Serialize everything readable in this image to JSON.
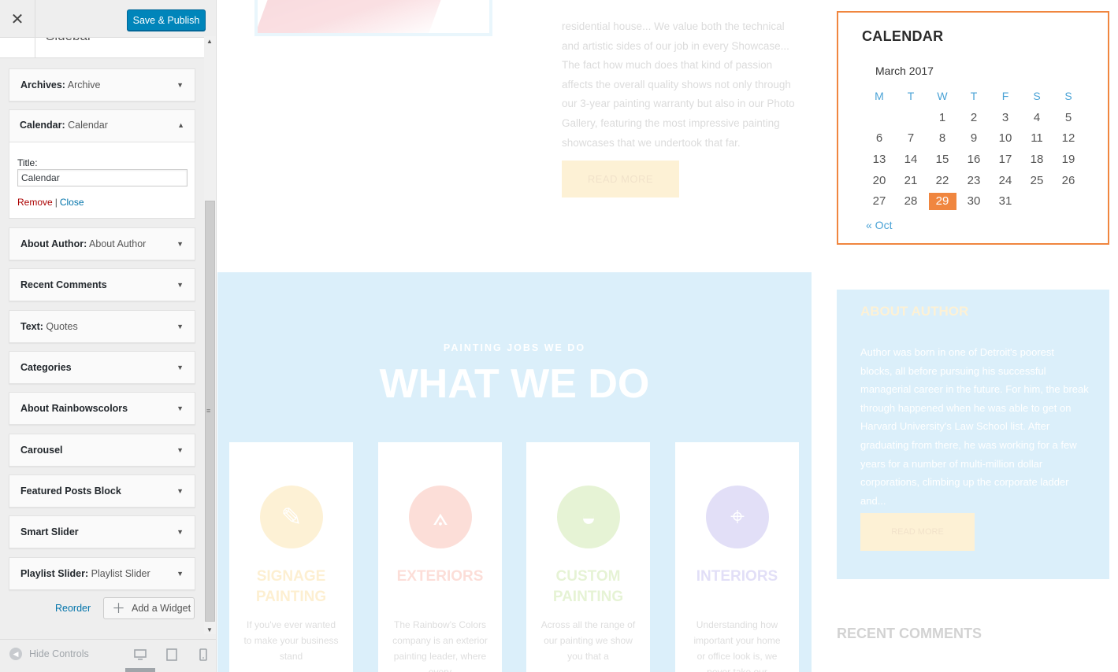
{
  "customizer": {
    "close_icon": "close-icon",
    "publish_label": "Save & Publish",
    "panel_title": "Sidebar",
    "widgets_top": [
      {
        "type": "Archives:",
        "title": "Archive"
      }
    ],
    "open_widget": {
      "type": "Calendar:",
      "title": "Calendar",
      "field_label": "Title:",
      "field_value": "Calendar",
      "remove_label": "Remove",
      "separator": "|",
      "close_label": "Close"
    },
    "widgets": [
      {
        "type": "About Author:",
        "title": "About Author"
      },
      {
        "type": "Recent Comments",
        "title": ""
      },
      {
        "type": "Text:",
        "title": "Quotes"
      },
      {
        "type": "Categories",
        "title": ""
      },
      {
        "type": "About Rainbowscolors",
        "title": ""
      },
      {
        "type": "Carousel",
        "title": ""
      },
      {
        "type": "Featured Posts Block",
        "title": ""
      },
      {
        "type": "Smart Slider",
        "title": ""
      },
      {
        "type": "Playlist Slider:",
        "title": "Playlist Slider"
      }
    ],
    "reorder_label": "Reorder",
    "add_widget_label": "Add a Widget",
    "hide_controls_label": "Hide Controls",
    "accent_color": "#0085ba"
  },
  "preview": {
    "post_text": "residential house... We value both the technical and artistic sides of our job in every Showcase... The fact how much does that kind of passion affects the overall quality shows not only through our 3-year painting warranty but also in our Photo Gallery, featuring the most impressive painting showcases that we undertook that far.",
    "read_more_label": "READ MORE",
    "section_subtitle": "PAINTING JOBS WE DO",
    "section_title": "WHAT WE DO",
    "services": [
      {
        "title": "SIGNAGE PAINTING",
        "text": "If you've ever wanted to make your business stand",
        "color": "#f5c040",
        "icon": "palette-icon",
        "glyph": "✎",
        "title_color": "#f5b830"
      },
      {
        "title": "EXTERIORS",
        "text": "The Rainbow's Colors company is an exterior painting leader, where every",
        "color": "#f06a50",
        "icon": "compass-icon",
        "glyph": "⟑",
        "title_color": "#f06a50"
      },
      {
        "title": "CUSTOM PAINTING",
        "text": "Across all the range of our painting we show you that a",
        "color": "#8cc63f",
        "icon": "beret-icon",
        "glyph": "◒",
        "title_color": "#8cc63f"
      },
      {
        "title": "INTERIORS",
        "text": "Understanding how important your home or office look is, we never take our",
        "color": "#7b6fd8",
        "icon": "lamp-icon",
        "glyph": "⌖",
        "title_color": "#7b6fd8"
      }
    ],
    "calendar": {
      "widget_title": "CALENDAR",
      "caption": "March 2017",
      "weekdays": [
        "M",
        "T",
        "W",
        "T",
        "F",
        "S",
        "S"
      ],
      "weeks": [
        [
          "",
          "",
          "1",
          "2",
          "3",
          "4",
          "5"
        ],
        [
          "6",
          "7",
          "8",
          "9",
          "10",
          "11",
          "12"
        ],
        [
          "13",
          "14",
          "15",
          "16",
          "17",
          "18",
          "19"
        ],
        [
          "20",
          "21",
          "22",
          "23",
          "24",
          "25",
          "26"
        ],
        [
          "27",
          "28",
          "29",
          "30",
          "31",
          "",
          ""
        ]
      ],
      "today": "29",
      "prev_link": "« Oct",
      "accent_color": "#f0863f"
    },
    "about_author": {
      "title": "ABOUT AUTHOR",
      "text": "Author was born in one of Detroit's poorest blocks, all before pursuing his successful managerial career in the future. For him, the break through happened when he was able to get on Harvard University's Law School list. After graduating from there, he was working for a few years for a number of multi-million dollar corporations, climbing up the corporate ladder and...",
      "button_label": "READ MORE"
    },
    "recent_comments_title": "RECENT COMMENTS"
  }
}
